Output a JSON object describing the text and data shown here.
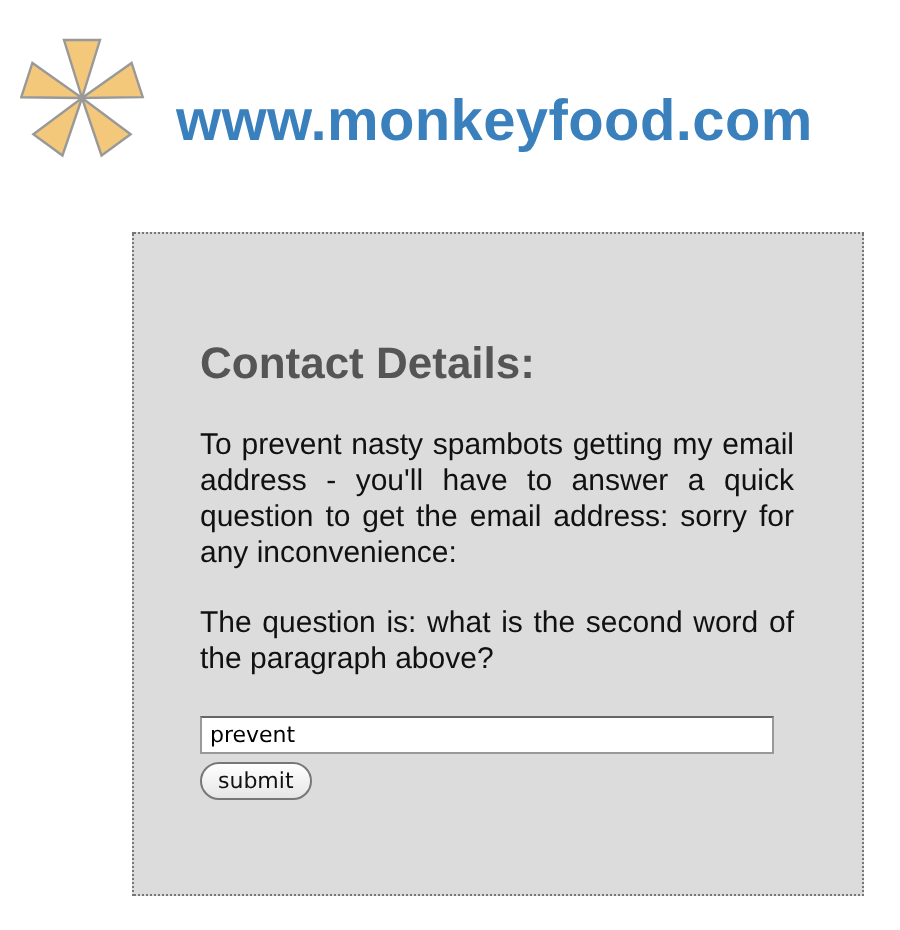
{
  "site": {
    "url": "www.monkeyfood.com"
  },
  "contact": {
    "heading": "Contact Details:",
    "paragraphs": [
      "To prevent nasty spambots getting my email address - you'll have to answer a quick question to get the email address: sorry for any inconvenience:",
      "The question is: what is the second word of the paragraph above?"
    ],
    "answer": {
      "value": "prevent"
    },
    "submit": "submit"
  }
}
